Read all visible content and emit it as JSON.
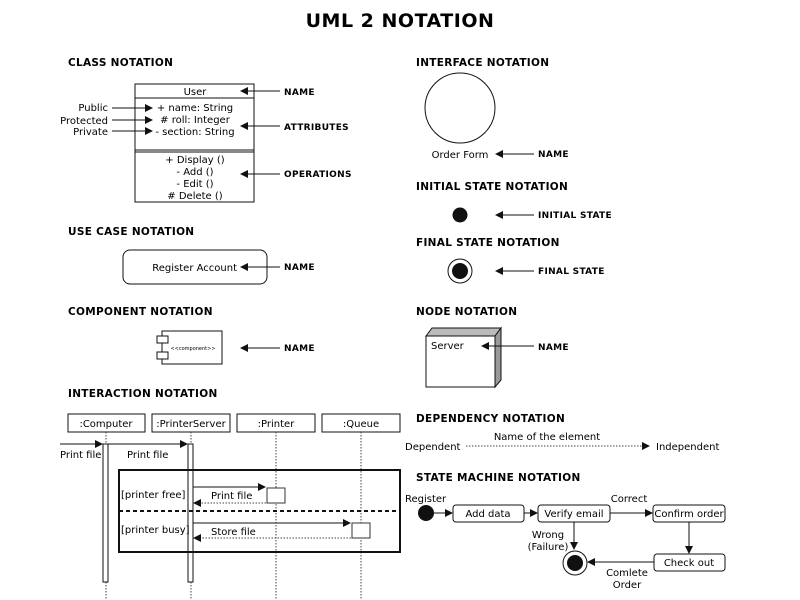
{
  "title": "UML 2 NOTATION",
  "class_notation": {
    "heading": "CLASS NOTATION",
    "class_name": "User",
    "attributes": [
      "+ name: String",
      "# roll: Integer",
      "- section: String"
    ],
    "operations": [
      "+ Display ()",
      "- Add ()",
      "- Edit ()",
      "# Delete ()"
    ],
    "visibility_labels": [
      "Public",
      "Protected",
      "Private"
    ],
    "callouts": {
      "name": "NAME",
      "attributes": "ATTRIBUTES",
      "operations": "OPERATIONS"
    }
  },
  "use_case_notation": {
    "heading": "USE CASE NOTATION",
    "use_case": "Register Account",
    "callout": "NAME"
  },
  "component_notation": {
    "heading": "COMPONENT NOTATION",
    "stereotype": "<<component>>",
    "callout": "NAME"
  },
  "interaction_notation": {
    "heading": "INTERACTION NOTATION",
    "lifelines": [
      ":Computer",
      ":PrinterServer",
      ":Printer",
      ":Queue"
    ],
    "messages": [
      "Print file",
      "Print file"
    ],
    "fragment_guards": [
      "[printer free]",
      "[printer busy]"
    ],
    "fragment_messages": [
      "Print file",
      "Store file"
    ]
  },
  "interface_notation": {
    "heading": "INTERFACE NOTATION",
    "interface_name": "Order Form",
    "callout": "NAME"
  },
  "initial_state_notation": {
    "heading": "INITIAL STATE NOTATION",
    "callout": "INITIAL STATE"
  },
  "final_state_notation": {
    "heading": "FINAL STATE NOTATION",
    "callout": "FINAL STATE"
  },
  "node_notation": {
    "heading": "NODE NOTATION",
    "node_name": "Server",
    "callout": "NAME"
  },
  "dependency_notation": {
    "heading": "DEPENDENCY NOTATION",
    "element_name": "Name of the element",
    "source": "Dependent",
    "target": "Independent"
  },
  "state_machine_notation": {
    "heading": "STATE MACHINE NOTATION",
    "states": [
      "Add data",
      "Verify email",
      "Confirm order",
      "Check out"
    ],
    "transitions": {
      "start": "Register",
      "correct": "Correct",
      "wrong_line1": "Wrong",
      "wrong_line2": "(Failure)",
      "complete_line1": "Comlete",
      "complete_line2": "Order"
    }
  }
}
